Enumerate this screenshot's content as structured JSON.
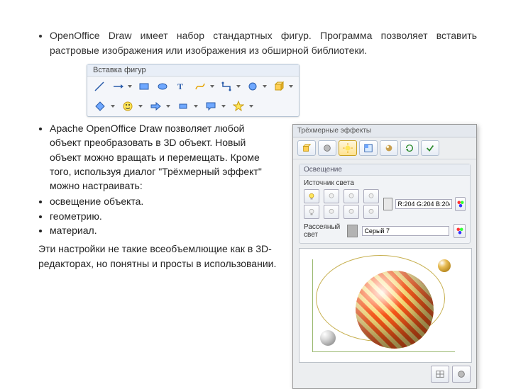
{
  "intro_bullet": "OpenOffice Draw имеет набор стандартных фигур. Программа позволяет вставить растровые изображения или изображения из обширной библиотеки.",
  "toolbar": {
    "title": "Вставка фигур",
    "row1": [
      "line",
      "arrow",
      "rect",
      "ellipse",
      "text",
      "curve",
      "connector",
      "shapes",
      "3d"
    ],
    "row2": [
      "basic",
      "symbol",
      "block",
      "flow",
      "callout",
      "star"
    ]
  },
  "bullets2": {
    "lead": "Apache OpenOffice Draw позволяет любой объект преобразовать в 3D объект. Новый объект можно вращать и перемещать. Кроме того, используя диалог \"Трёхмерный эффект\" можно настраивать:",
    "items": [
      "освещение объекта.",
      "геометрию.",
      "материал."
    ]
  },
  "closing": "Эти настройки не такие всеобъемлющие как в 3D-редакторах, но понятны и просты в использовании.",
  "panel": {
    "title": "Трёхмерные эффекты",
    "group1": "Освещение",
    "light_label": "Источник света",
    "color_value": "R:204 G:204 B:204",
    "group2_label": "Рассеяный свет",
    "group2_value": "Серый 7"
  }
}
